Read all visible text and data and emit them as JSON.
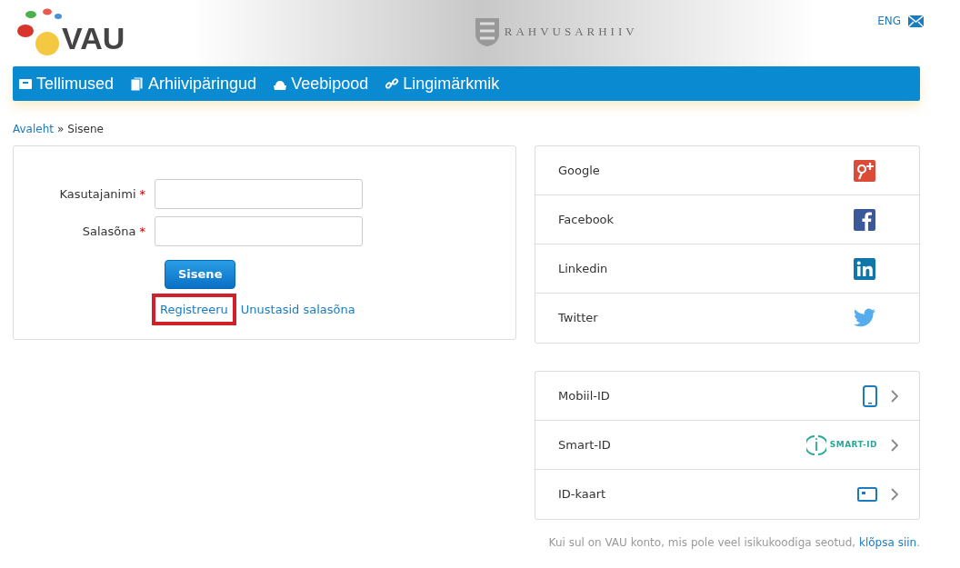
{
  "header": {
    "logo": "VAU",
    "archive_name": "RAHVUSARHIIV",
    "language": "ENG"
  },
  "nav": [
    {
      "label": "Tellimused",
      "kind": "orders"
    },
    {
      "label": "Arhiivipäringud",
      "kind": "queries"
    },
    {
      "label": "Veebipood",
      "kind": "shop"
    },
    {
      "label": "Lingimärkmik",
      "kind": "links"
    }
  ],
  "breadcrumb": [
    {
      "label": "Avaleht",
      "kind": "link"
    },
    {
      "label": "»",
      "kind": "separator"
    },
    {
      "label": "Sisene",
      "kind": "current"
    }
  ],
  "login_form": {
    "fields": [
      {
        "label": "Kasutajanimi",
        "required_mark": "*"
      },
      {
        "label": "Salasõna",
        "required_mark": "*"
      }
    ],
    "submit": "Sisene",
    "links": [
      {
        "label": "Registreeru",
        "highlighted": true
      },
      {
        "label": "Unustasid salasõna",
        "highlighted": false
      }
    ]
  },
  "social_logins": [
    {
      "label": "Google",
      "kind": "google"
    },
    {
      "label": "Facebook",
      "kind": "facebook"
    },
    {
      "label": "Linkedin",
      "kind": "linkedin"
    },
    {
      "label": "Twitter",
      "kind": "twitter"
    }
  ],
  "id_logins": [
    {
      "label": "Mobiil-ID",
      "kind": "mobile"
    },
    {
      "label": "Smart-ID",
      "kind": "smartid",
      "logo_text": "SMART-ID"
    },
    {
      "label": "ID-kaart",
      "kind": "idcard"
    }
  ],
  "footer_note": {
    "text": "Kui sul on VAU konto, mis pole veel isikukoodiga seotud, ",
    "link": "klõpsa siin",
    "end": "."
  }
}
